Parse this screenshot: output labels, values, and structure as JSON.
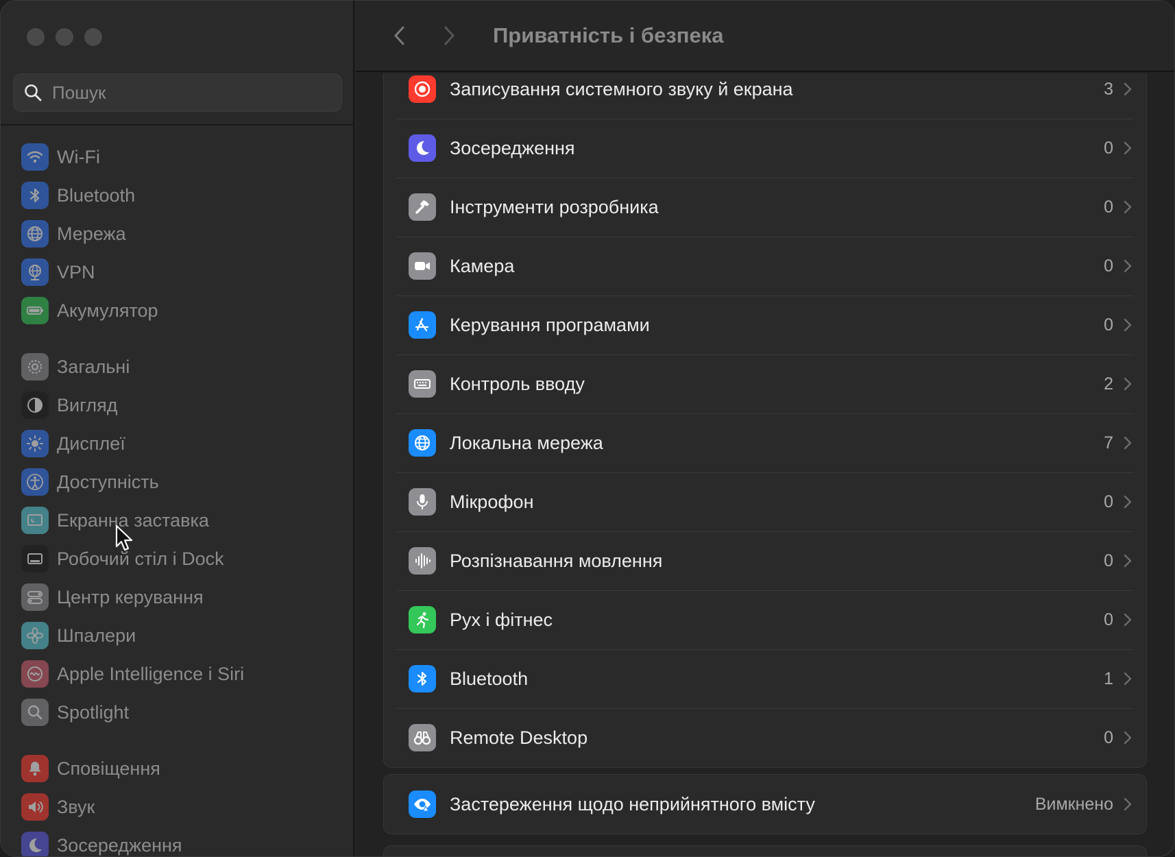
{
  "sidebar": {
    "search_placeholder": "Пошук",
    "groups": [
      [
        {
          "label": "Wi-Fi",
          "icon": "wifi-icon",
          "color": "#3478f6"
        },
        {
          "label": "Bluetooth",
          "icon": "bluetooth-icon",
          "color": "#3478f6"
        },
        {
          "label": "Мережа",
          "icon": "globe-icon",
          "color": "#3478f6"
        },
        {
          "label": "VPN",
          "icon": "vpn-globe-icon",
          "color": "#3478f6"
        },
        {
          "label": "Акумулятор",
          "icon": "battery-icon",
          "color": "#34c759"
        }
      ],
      [
        {
          "label": "Загальні",
          "icon": "gear-icon",
          "color": "#8e8e93"
        },
        {
          "label": "Вигляд",
          "icon": "appearance-icon",
          "color": "#1c1c1e"
        },
        {
          "label": "Дисплеї",
          "icon": "sun-icon",
          "color": "#3478f6"
        },
        {
          "label": "Доступність",
          "icon": "accessibility-icon",
          "color": "#3478f6"
        },
        {
          "label": "Екранна заставка",
          "icon": "screensaver-icon",
          "color": "#5ac8d6"
        },
        {
          "label": "Робочий стіл і Dock",
          "icon": "dock-icon",
          "color": "#1c1c1e"
        },
        {
          "label": "Центр керування",
          "icon": "control-center-icon",
          "color": "#8e8e93"
        },
        {
          "label": "Шпалери",
          "icon": "flower-icon",
          "color": "#5ac8d6"
        },
        {
          "label": "Apple Intelligence і Siri",
          "icon": "siri-icon",
          "color": "#d06070"
        },
        {
          "label": "Spotlight",
          "icon": "spotlight-icon",
          "color": "#8e8e93"
        }
      ],
      [
        {
          "label": "Сповіщення",
          "icon": "bell-icon",
          "color": "#ff3b30"
        },
        {
          "label": "Звук",
          "icon": "speaker-icon",
          "color": "#ff3b30"
        },
        {
          "label": "Зосередження",
          "icon": "moon-icon",
          "color": "#5e5ce6"
        }
      ]
    ]
  },
  "toolbar": {
    "title": "Приватність і безпека"
  },
  "privacy_list": [
    {
      "label": "Записування системного звуку й екрана",
      "value": "3",
      "icon": "record-icon",
      "color": "#ff3b30"
    },
    {
      "label": "Зосередження",
      "value": "0",
      "icon": "moon-icon",
      "color": "#5e5ce6"
    },
    {
      "label": "Інструменти розробника",
      "value": "0",
      "icon": "hammer-icon",
      "color": "#8e8e93"
    },
    {
      "label": "Камера",
      "value": "0",
      "icon": "camera-icon",
      "color": "#8e8e93"
    },
    {
      "label": "Керування програмами",
      "value": "0",
      "icon": "app-store-icon",
      "color": "#1a8cff"
    },
    {
      "label": "Контроль вводу",
      "value": "2",
      "icon": "keyboard-icon",
      "color": "#8e8e93"
    },
    {
      "label": "Локальна мережа",
      "value": "7",
      "icon": "globe-icon",
      "color": "#1a8cff"
    },
    {
      "label": "Мікрофон",
      "value": "0",
      "icon": "microphone-icon",
      "color": "#8e8e93"
    },
    {
      "label": "Розпізнавання мовлення",
      "value": "0",
      "icon": "waveform-icon",
      "color": "#8e8e93"
    },
    {
      "label": "Рух і фітнес",
      "value": "0",
      "icon": "fitness-icon",
      "color": "#34c759"
    },
    {
      "label": "Bluetooth",
      "value": "1",
      "icon": "bluetooth-icon",
      "color": "#1a8cff"
    },
    {
      "label": "Remote Desktop",
      "value": "0",
      "icon": "binoculars-icon",
      "color": "#8e8e93"
    }
  ],
  "content_warning": {
    "label": "Застереження щодо неприйнятного вмісту",
    "value": "Вимкнено",
    "icon": "eye-warning-icon",
    "color": "#1a8cff"
  }
}
